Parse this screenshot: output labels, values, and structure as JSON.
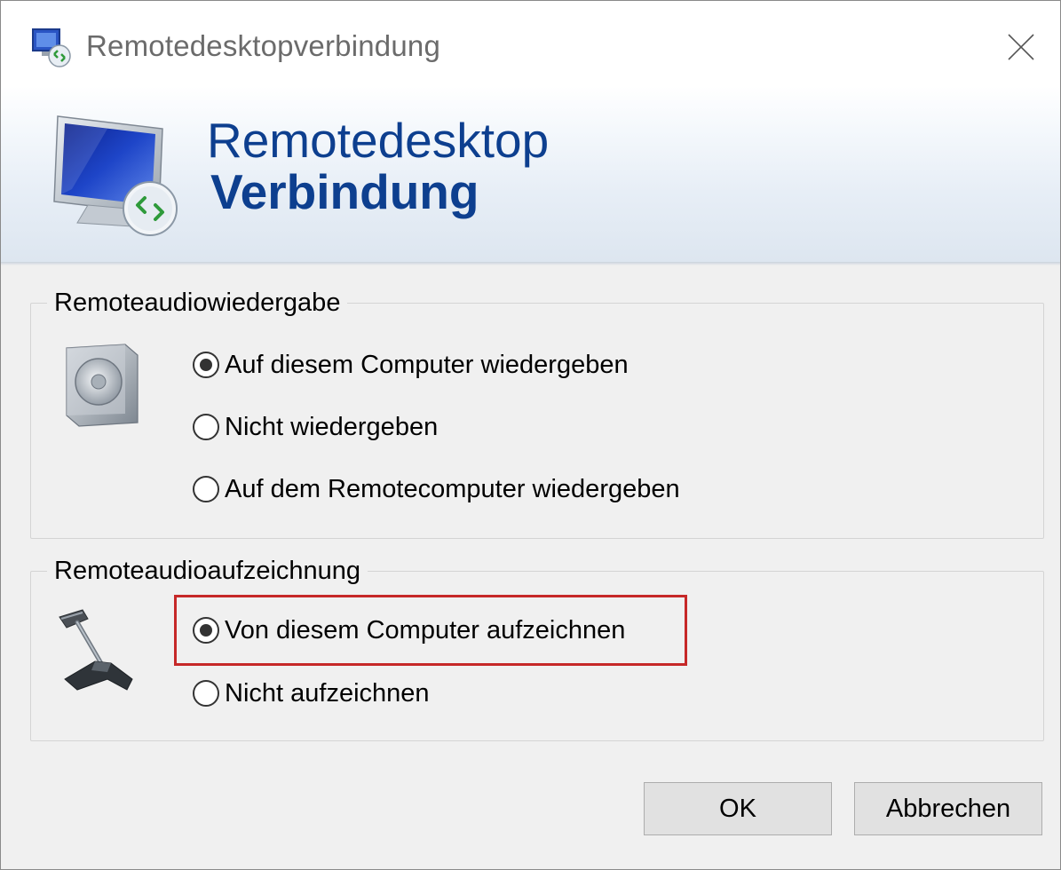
{
  "window": {
    "title": "Remotedesktopverbindung",
    "icons": {
      "title": "remote-desktop-icon",
      "close": "close-icon"
    }
  },
  "banner": {
    "line1": "Remotedesktop",
    "line2": "Verbindung",
    "icon": "remote-desktop-monitor-icon",
    "color": "#0d3f8f"
  },
  "playback": {
    "legend": "Remoteaudiowiedergabe",
    "icon": "speaker-icon",
    "options": [
      {
        "label": "Auf diesem Computer wiedergeben",
        "checked": true
      },
      {
        "label": "Nicht wiedergeben",
        "checked": false
      },
      {
        "label": "Auf dem Remotecomputer wiedergeben",
        "checked": false
      }
    ]
  },
  "recording": {
    "legend": "Remoteaudioaufzeichnung",
    "icon": "microphone-icon",
    "options": [
      {
        "label": "Von diesem Computer aufzeichnen",
        "checked": true,
        "highlighted": true
      },
      {
        "label": "Nicht aufzeichnen",
        "checked": false
      }
    ],
    "highlight_color": "#c62828"
  },
  "buttons": {
    "ok": "OK",
    "cancel": "Abbrechen"
  }
}
